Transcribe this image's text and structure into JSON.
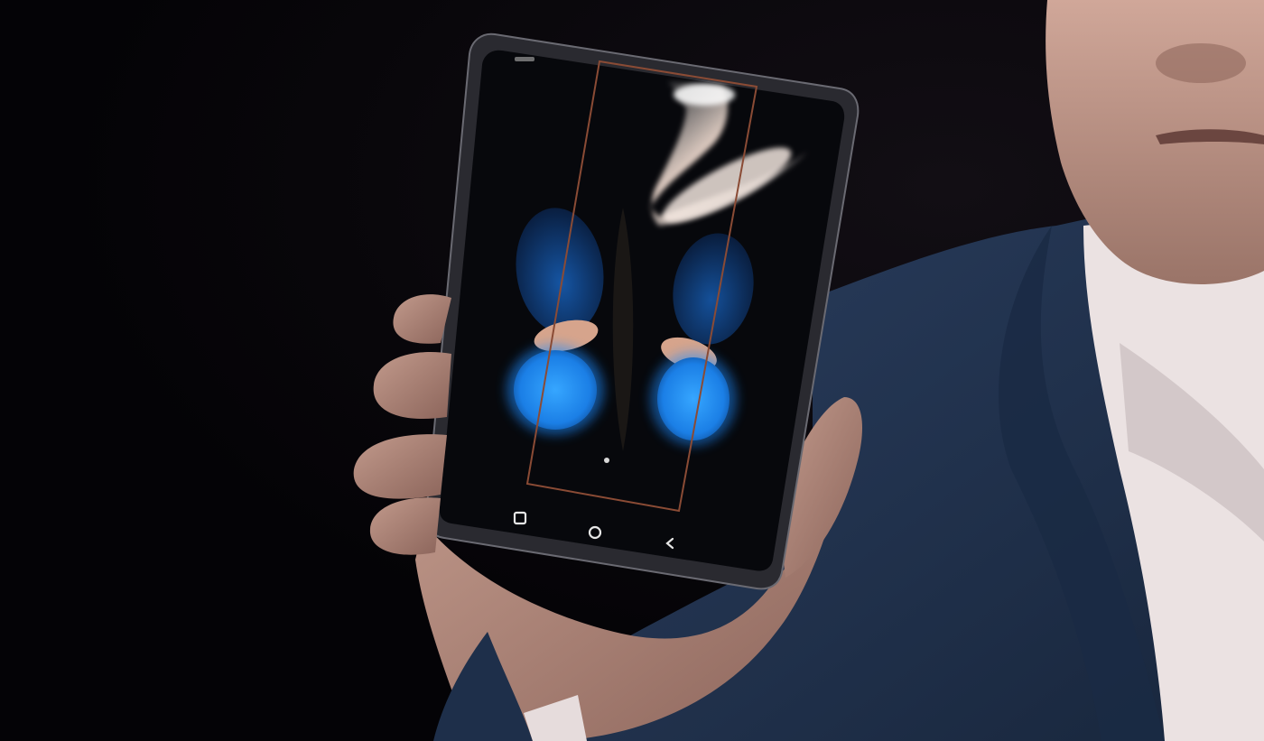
{
  "scene": {
    "description_colors": {
      "background": "#050407",
      "jacket": "#20324e",
      "shirt": "#e9e0e0",
      "skin": "#a27c72",
      "phone_frame": "#2a2a2f",
      "screen": "#07080c",
      "butterfly_blue": "#1e8cff",
      "butterfly_tan": "#d39f88",
      "fold_overlay_border": "#8a4b35"
    },
    "phone": {
      "navigation_bar": {
        "icons": [
          "recent-apps-icon",
          "home-icon",
          "back-icon"
        ]
      },
      "wallpaper": "butterfly",
      "overlay": "fold-outline-rectangle"
    }
  }
}
